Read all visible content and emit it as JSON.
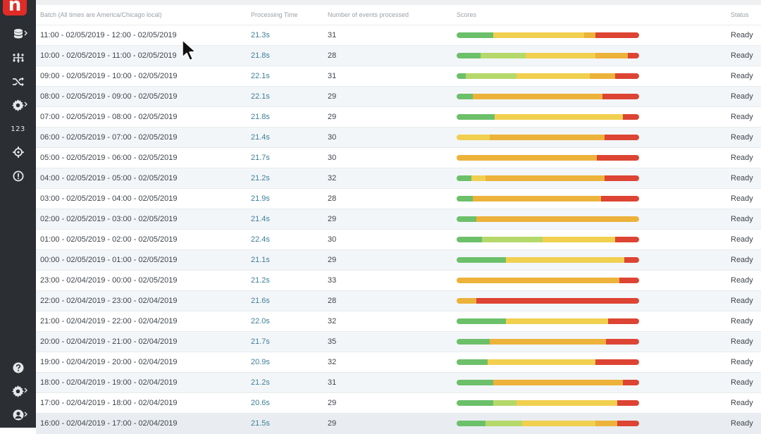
{
  "colors": {
    "green": "#6cc06a",
    "lightgreen": "#b5d86a",
    "yellow": "#f1cf4f",
    "amber": "#ecb23a",
    "red": "#dd4433",
    "accent": "#e02b27"
  },
  "sidebar": {
    "logo": "n",
    "items": [
      {
        "icon": "database-icon"
      },
      {
        "icon": "network-icon"
      },
      {
        "icon": "shuffle-icon"
      },
      {
        "icon": "gear-icon"
      },
      {
        "icon": "numbers-icon",
        "text": "123"
      },
      {
        "icon": "crosshair-icon"
      },
      {
        "icon": "alert-icon"
      },
      {
        "icon": "help-icon"
      },
      {
        "icon": "settings-icon"
      },
      {
        "icon": "user-icon"
      }
    ]
  },
  "table": {
    "headers": {
      "batch": "Batch (All times are America/Chicago local)",
      "processing_time": "Processing Time",
      "events": "Number of events processed",
      "scores": "Scores",
      "status": "Status"
    },
    "rows": [
      {
        "batch": "11:00 - 02/05/2019 - 12:00 - 02/05/2019",
        "time": "21.3s",
        "count": "31",
        "status": "Ready",
        "scores": [
          [
            "green",
            0.2
          ],
          [
            "yellow",
            0.5
          ],
          [
            "amber",
            0.06
          ],
          [
            "red",
            0.24
          ]
        ]
      },
      {
        "batch": "10:00 - 02/05/2019 - 11:00 - 02/05/2019",
        "time": "21.8s",
        "count": "28",
        "status": "Ready",
        "scores": [
          [
            "green",
            0.13
          ],
          [
            "lightgreen",
            0.25
          ],
          [
            "yellow",
            0.38
          ],
          [
            "amber",
            0.18
          ],
          [
            "red",
            0.06
          ]
        ]
      },
      {
        "batch": "09:00 - 02/05/2019 - 10:00 - 02/05/2019",
        "time": "22.1s",
        "count": "31",
        "status": "Ready",
        "scores": [
          [
            "green",
            0.05
          ],
          [
            "lightgreen",
            0.28
          ],
          [
            "yellow",
            0.4
          ],
          [
            "amber",
            0.14
          ],
          [
            "red",
            0.13
          ]
        ]
      },
      {
        "batch": "08:00 - 02/05/2019 - 09:00 - 02/05/2019",
        "time": "22.1s",
        "count": "29",
        "status": "Ready",
        "scores": [
          [
            "green",
            0.09
          ],
          [
            "amber",
            0.71
          ],
          [
            "red",
            0.2
          ]
        ]
      },
      {
        "batch": "07:00 - 02/05/2019 - 08:00 - 02/05/2019",
        "time": "21.8s",
        "count": "29",
        "status": "Ready",
        "scores": [
          [
            "green",
            0.21
          ],
          [
            "yellow",
            0.7
          ],
          [
            "red",
            0.09
          ]
        ]
      },
      {
        "batch": "06:00 - 02/05/2019 - 07:00 - 02/05/2019",
        "time": "21.4s",
        "count": "30",
        "status": "Ready",
        "scores": [
          [
            "yellow",
            0.18
          ],
          [
            "amber",
            0.63
          ],
          [
            "red",
            0.19
          ]
        ]
      },
      {
        "batch": "05:00 - 02/05/2019 - 06:00 - 02/05/2019",
        "time": "21.7s",
        "count": "30",
        "status": "Ready",
        "scores": [
          [
            "amber",
            0.77
          ],
          [
            "red",
            0.23
          ]
        ]
      },
      {
        "batch": "04:00 - 02/05/2019 - 05:00 - 02/05/2019",
        "time": "21.2s",
        "count": "32",
        "status": "Ready",
        "scores": [
          [
            "green",
            0.08
          ],
          [
            "yellow",
            0.08
          ],
          [
            "amber",
            0.65
          ],
          [
            "red",
            0.19
          ]
        ]
      },
      {
        "batch": "03:00 - 02/05/2019 - 04:00 - 02/05/2019",
        "time": "21.9s",
        "count": "28",
        "status": "Ready",
        "scores": [
          [
            "green",
            0.09
          ],
          [
            "amber",
            0.7
          ],
          [
            "red",
            0.21
          ]
        ]
      },
      {
        "batch": "02:00 - 02/05/2019 - 03:00 - 02/05/2019",
        "time": "21.4s",
        "count": "29",
        "status": "Ready",
        "scores": [
          [
            "green",
            0.11
          ],
          [
            "amber",
            0.89
          ]
        ]
      },
      {
        "batch": "01:00 - 02/05/2019 - 02:00 - 02/05/2019",
        "time": "22.4s",
        "count": "30",
        "status": "Ready",
        "scores": [
          [
            "green",
            0.14
          ],
          [
            "lightgreen",
            0.33
          ],
          [
            "yellow",
            0.4
          ],
          [
            "red",
            0.13
          ]
        ]
      },
      {
        "batch": "00:00 - 02/05/2019 - 01:00 - 02/05/2019",
        "time": "21.1s",
        "count": "29",
        "status": "Ready",
        "scores": [
          [
            "green",
            0.27
          ],
          [
            "yellow",
            0.65
          ],
          [
            "red",
            0.08
          ]
        ]
      },
      {
        "batch": "23:00 - 02/04/2019 - 00:00 - 02/05/2019",
        "time": "21.2s",
        "count": "33",
        "status": "Ready",
        "scores": [
          [
            "amber",
            0.89
          ],
          [
            "red",
            0.11
          ]
        ]
      },
      {
        "batch": "22:00 - 02/04/2019 - 23:00 - 02/04/2019",
        "time": "21.6s",
        "count": "28",
        "status": "Ready",
        "scores": [
          [
            "amber",
            0.11
          ],
          [
            "red",
            0.89
          ]
        ]
      },
      {
        "batch": "21:00 - 02/04/2019 - 22:00 - 02/04/2019",
        "time": "22.0s",
        "count": "32",
        "status": "Ready",
        "scores": [
          [
            "green",
            0.27
          ],
          [
            "yellow",
            0.56
          ],
          [
            "red",
            0.17
          ]
        ]
      },
      {
        "batch": "20:00 - 02/04/2019 - 21:00 - 02/04/2019",
        "time": "21.7s",
        "count": "35",
        "status": "Ready",
        "scores": [
          [
            "green",
            0.18
          ],
          [
            "amber",
            0.64
          ],
          [
            "red",
            0.18
          ]
        ]
      },
      {
        "batch": "19:00 - 02/04/2019 - 20:00 - 02/04/2019",
        "time": "20.9s",
        "count": "32",
        "status": "Ready",
        "scores": [
          [
            "green",
            0.17
          ],
          [
            "yellow",
            0.59
          ],
          [
            "red",
            0.24
          ]
        ]
      },
      {
        "batch": "18:00 - 02/04/2019 - 19:00 - 02/04/2019",
        "time": "21.2s",
        "count": "31",
        "status": "Ready",
        "scores": [
          [
            "green",
            0.2
          ],
          [
            "amber",
            0.71
          ],
          [
            "red",
            0.09
          ]
        ]
      },
      {
        "batch": "17:00 - 02/04/2019 - 18:00 - 02/04/2019",
        "time": "20.6s",
        "count": "29",
        "status": "Ready",
        "scores": [
          [
            "green",
            0.2
          ],
          [
            "lightgreen",
            0.13
          ],
          [
            "yellow",
            0.55
          ],
          [
            "red",
            0.12
          ]
        ]
      },
      {
        "batch": "16:00 - 02/04/2019 - 17:00 - 02/04/2019",
        "time": "21.5s",
        "count": "29",
        "status": "Ready",
        "scores": [
          [
            "green",
            0.16
          ],
          [
            "lightgreen",
            0.2
          ],
          [
            "yellow",
            0.4
          ],
          [
            "amber",
            0.12
          ],
          [
            "red",
            0.12
          ]
        ]
      }
    ]
  }
}
